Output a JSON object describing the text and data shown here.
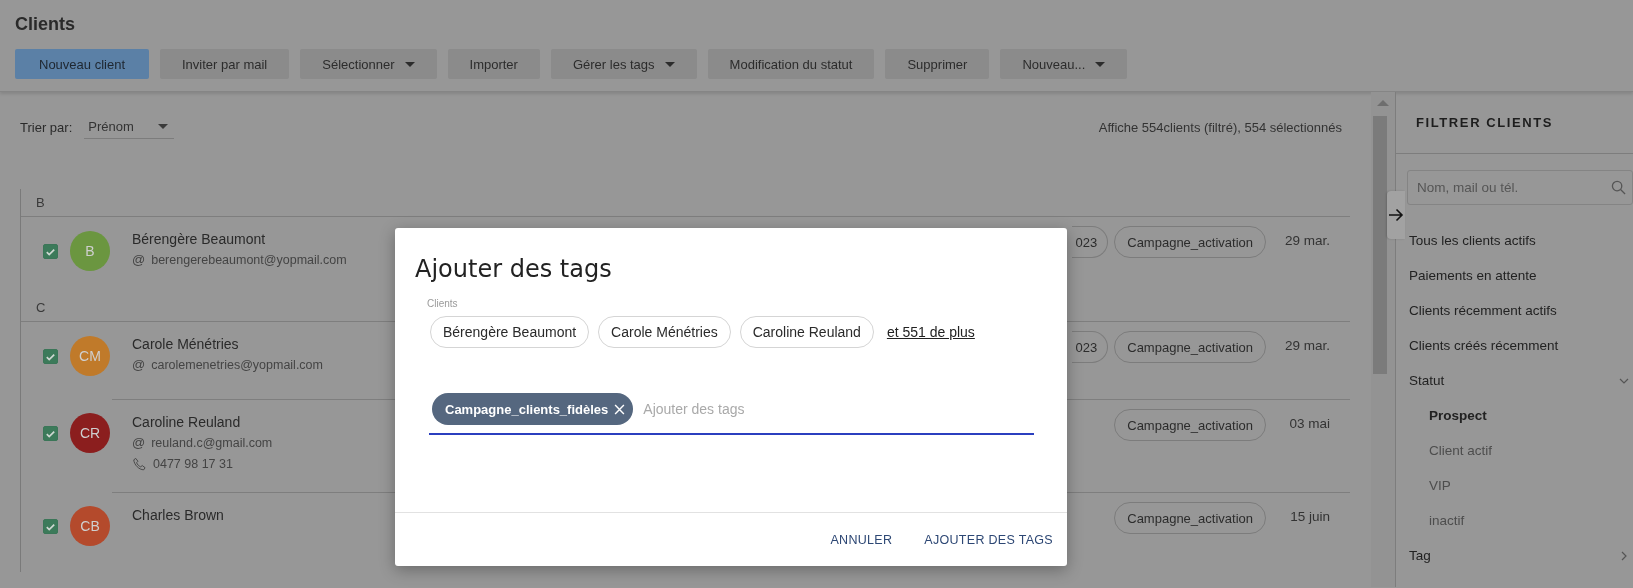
{
  "header": {
    "title": "Clients",
    "toolbar": [
      {
        "label": "Nouveau client",
        "kind": "primary"
      },
      {
        "label": "Inviter par mail",
        "kind": "plain"
      },
      {
        "label": "Sélectionner",
        "kind": "dropdown"
      },
      {
        "label": "Importer",
        "kind": "plain"
      },
      {
        "label": "Gérer les tags",
        "kind": "dropdown"
      },
      {
        "label": "Modification du statut",
        "kind": "plain"
      },
      {
        "label": "Supprimer",
        "kind": "plain"
      },
      {
        "label": "Nouveau...",
        "kind": "dropdown"
      }
    ]
  },
  "list": {
    "sort": {
      "label": "Trier par:",
      "value": "Prénom"
    },
    "summary": "Affiche 554clients (filtré), 554 sélectionnés",
    "sections": [
      {
        "letter": "B",
        "rows": [
          {
            "name": "Bérengère Beaumont",
            "initials": "B",
            "color": "#6b9640",
            "checked": true,
            "email_icon": "@",
            "email": "berengerebeaumont@yopmail.com",
            "tags": [
              {
                "label": "023",
                "clipped": true
              },
              {
                "label": "Campagne_activation",
                "clipped": false
              }
            ],
            "date": "29 mar."
          }
        ]
      },
      {
        "letter": "C",
        "rows": [
          {
            "name": "Carole Ménétries",
            "initials": "CM",
            "color": "#c07a2a",
            "checked": true,
            "email_icon": "@",
            "email": "carolemenetries@yopmail.com",
            "tags": [
              {
                "label": "023",
                "clipped": true
              },
              {
                "label": "Campagne_activation",
                "clipped": false
              }
            ],
            "date": "29 mar."
          },
          {
            "name": "Caroline Reuland",
            "initials": "CR",
            "color": "#8b1e1e",
            "checked": true,
            "email_icon": "@",
            "email": "reuland.c@gmail.com",
            "phone": "0477 98 17 31",
            "tags": [
              {
                "label": "Campagne_activation",
                "clipped": false
              }
            ],
            "date": "03 mai"
          },
          {
            "name": "Charles Brown",
            "initials": "CB",
            "color": "#b44a2c",
            "checked": true,
            "tags": [
              {
                "label": "Campagne_activation",
                "clipped": false
              }
            ],
            "date": "15 juin"
          }
        ]
      }
    ]
  },
  "sidebar": {
    "title": "FILTRER CLIENTS",
    "search": {
      "placeholder": "Nom, mail ou tél."
    },
    "items": [
      {
        "label": "Tous les clients actifs",
        "kind": "link"
      },
      {
        "label": "Paiements en attente",
        "kind": "link"
      },
      {
        "label": "Clients récemment actifs",
        "kind": "link"
      },
      {
        "label": "Clients créés récemment",
        "kind": "link"
      },
      {
        "label": "Statut",
        "kind": "group",
        "expanded": true,
        "children": [
          {
            "label": "Prospect",
            "selected": true
          },
          {
            "label": "Client actif",
            "selected": false
          },
          {
            "label": "VIP",
            "selected": false
          },
          {
            "label": "inactif",
            "selected": false
          }
        ]
      },
      {
        "label": "Tag",
        "kind": "group",
        "expanded": false
      }
    ]
  },
  "dialog": {
    "title": "Ajouter des tags",
    "clients_label": "Clients",
    "clients": [
      "Bérengère Beaumont",
      "Carole Ménétries",
      "Caroline Reuland"
    ],
    "more_link": "et 551 de plus",
    "tags": [
      "Campagne_clients_fidèles"
    ],
    "tag_input": {
      "placeholder": "Ajouter des tags"
    },
    "buttons": [
      "ANNULER",
      "AJOUTER DES TAGS"
    ]
  }
}
